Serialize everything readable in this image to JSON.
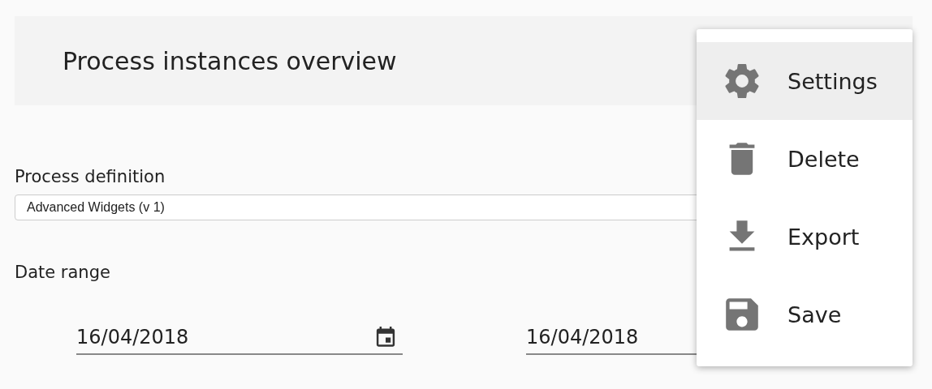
{
  "header": {
    "title": "Process instances overview"
  },
  "process_definition": {
    "label": "Process definition",
    "value": "Advanced Widgets (v 1)"
  },
  "date_range": {
    "label": "Date range",
    "fields": [
      {
        "value": "16/04/2018",
        "calendar_icon": true
      },
      {
        "value": "16/04/2018"
      }
    ]
  },
  "menu": {
    "items": [
      {
        "kind": "settings",
        "label": "Settings",
        "selected": true
      },
      {
        "kind": "delete",
        "label": "Delete",
        "selected": false
      },
      {
        "kind": "export",
        "label": "Export",
        "selected": false
      },
      {
        "kind": "save",
        "label": "Save",
        "selected": false
      }
    ]
  }
}
